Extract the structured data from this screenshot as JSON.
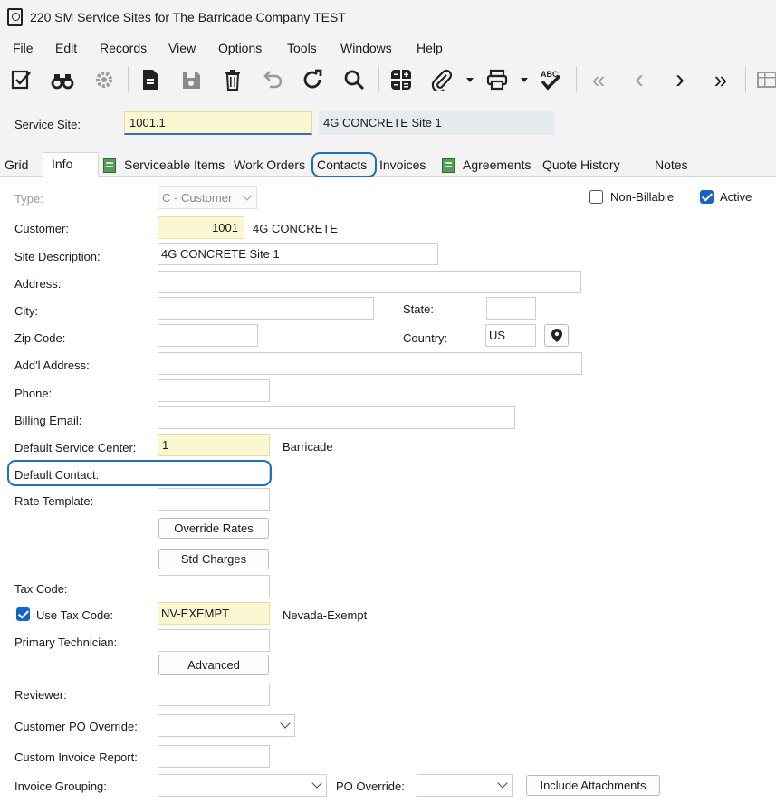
{
  "window": {
    "title": "220 SM Service Sites for The Barricade Company TEST"
  },
  "menu": [
    "File",
    "Edit",
    "Records",
    "View",
    "Options",
    "Tools",
    "Windows",
    "Help"
  ],
  "toolbar": {
    "icons": [
      "edit-checklist-icon",
      "binoculars-icon",
      "gear-settings-icon",
      "new-document-icon",
      "save-icon",
      "delete-trash-icon",
      "undo-icon",
      "refresh-icon",
      "search-icon",
      "calculator-icon",
      "attachment-paperclip-icon",
      "print-icon",
      "spellcheck-icon",
      "first-record-icon",
      "previous-record-icon",
      "next-record-icon",
      "last-record-icon",
      "grid-view-icon"
    ],
    "glyphs": {
      "first": "«",
      "prev": "‹",
      "next": "›",
      "last": "»",
      "abc": "ABC"
    }
  },
  "header": {
    "service_site_label": "Service Site:",
    "service_site_value": "1001.1",
    "service_site_description": "4G CONCRETE Site 1"
  },
  "tabs": [
    "Grid",
    "Info",
    "Serviceable Items",
    "Work Orders",
    "Contacts",
    "Invoices",
    "Agreements",
    "Quote History",
    "Notes"
  ],
  "active_tab": "Info",
  "form": {
    "type": {
      "label": "Type:",
      "value": "C - Customer"
    },
    "non_billable": {
      "label": "Non-Billable",
      "checked": false
    },
    "active": {
      "label": "Active",
      "checked": true
    },
    "customer": {
      "label": "Customer:",
      "value": "1001",
      "name": "4G CONCRETE"
    },
    "site_description": {
      "label": "Site Description:",
      "value": "4G CONCRETE Site 1"
    },
    "address": {
      "label": "Address:",
      "value": ""
    },
    "city": {
      "label": "City:",
      "value": ""
    },
    "state": {
      "label": "State:",
      "value": ""
    },
    "zip": {
      "label": "Zip Code:",
      "value": ""
    },
    "country": {
      "label": "Country:",
      "value": "US"
    },
    "addl_address": {
      "label": "Add'l Address:",
      "value": ""
    },
    "phone": {
      "label": "Phone:",
      "value": ""
    },
    "billing_email": {
      "label": "Billing Email:",
      "value": ""
    },
    "default_service_center": {
      "label": "Default Service Center:",
      "value": "1",
      "name": "Barricade"
    },
    "default_contact": {
      "label": "Default Contact:",
      "value": ""
    },
    "rate_template": {
      "label": "Rate Template:",
      "value": ""
    },
    "override_rates_button": "Override Rates",
    "std_charges_button": "Std Charges",
    "tax_code": {
      "label": "Tax Code:",
      "value": ""
    },
    "use_tax_code": {
      "label": "Use Tax Code:",
      "checked": true,
      "value": "NV-EXEMPT",
      "name": "Nevada-Exempt"
    },
    "primary_technician": {
      "label": "Primary Technician:",
      "value": ""
    },
    "advanced_button": "Advanced",
    "reviewer": {
      "label": "Reviewer:",
      "value": ""
    },
    "customer_po_override": {
      "label": "Customer PO Override:",
      "value": ""
    },
    "custom_invoice_report": {
      "label": "Custom Invoice Report:",
      "value": ""
    },
    "invoice_grouping": {
      "label": "Invoice Grouping:",
      "value": ""
    },
    "po_override": {
      "label": "PO Override:",
      "value": ""
    },
    "include_attachments_button": "Include Attachments"
  },
  "colors": {
    "accent": "#1f6fbf",
    "required_field": "#fbf7d2",
    "chrome": "#f3f3f3"
  }
}
